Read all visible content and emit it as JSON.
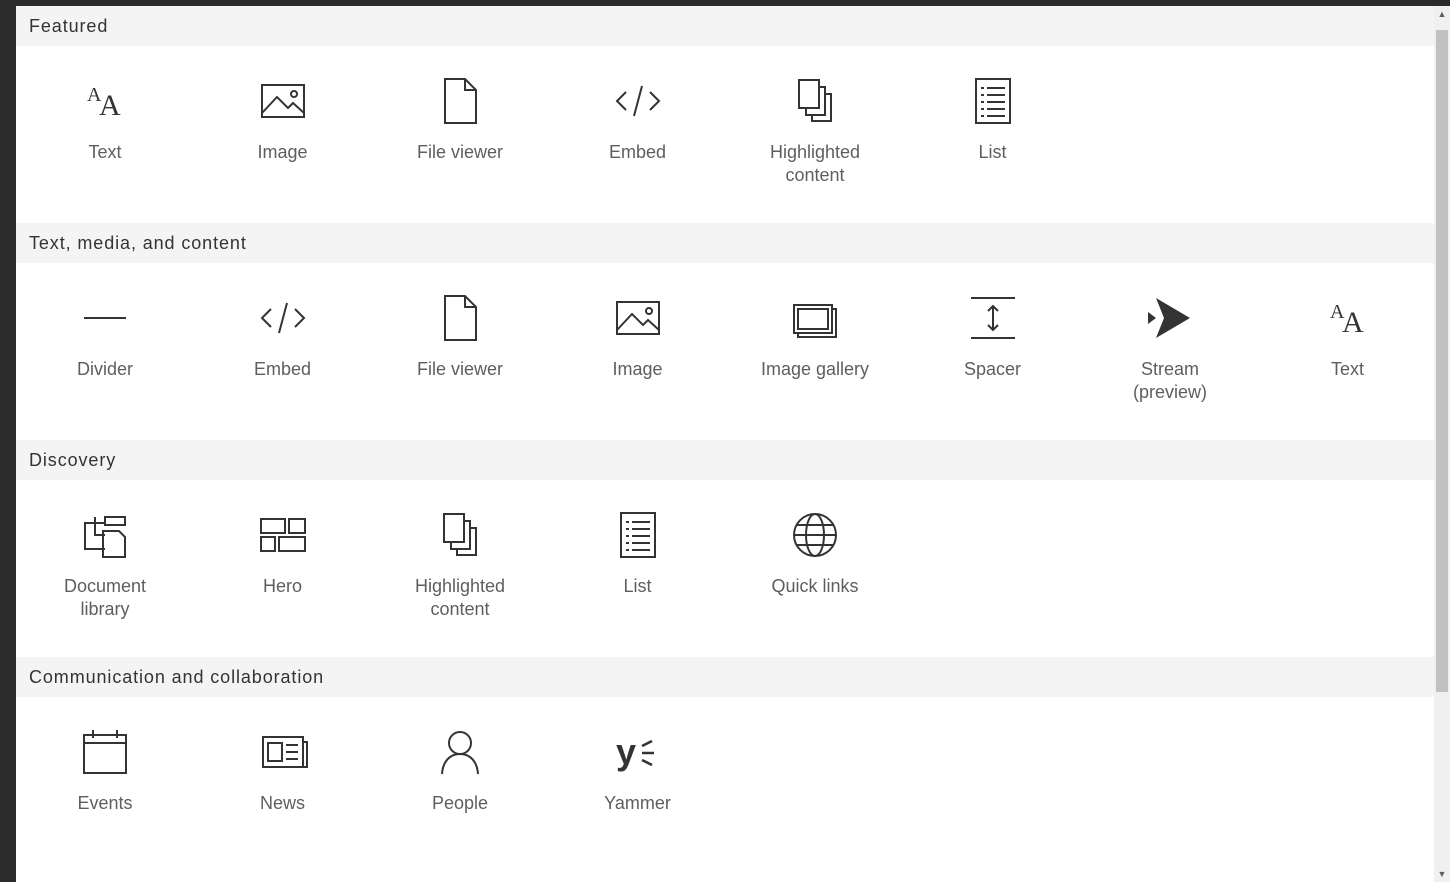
{
  "sections": [
    {
      "title": "Featured",
      "items": [
        {
          "label": "Text",
          "icon": "text-icon"
        },
        {
          "label": "Image",
          "icon": "image-icon"
        },
        {
          "label": "File viewer",
          "icon": "file-viewer-icon"
        },
        {
          "label": "Embed",
          "icon": "embed-icon"
        },
        {
          "label": "Highlighted content",
          "icon": "highlighted-content-icon"
        },
        {
          "label": "List",
          "icon": "list-icon"
        }
      ]
    },
    {
      "title": "Text, media, and content",
      "items": [
        {
          "label": "Divider",
          "icon": "divider-icon"
        },
        {
          "label": "Embed",
          "icon": "embed-icon"
        },
        {
          "label": "File viewer",
          "icon": "file-viewer-icon"
        },
        {
          "label": "Image",
          "icon": "image-icon"
        },
        {
          "label": "Image gallery",
          "icon": "image-gallery-icon"
        },
        {
          "label": "Spacer",
          "icon": "spacer-icon"
        },
        {
          "label": "Stream (preview)",
          "icon": "stream-icon"
        },
        {
          "label": "Text",
          "icon": "text-icon"
        }
      ]
    },
    {
      "title": "Discovery",
      "items": [
        {
          "label": "Document library",
          "icon": "document-library-icon"
        },
        {
          "label": "Hero",
          "icon": "hero-icon"
        },
        {
          "label": "Highlighted content",
          "icon": "highlighted-content-icon"
        },
        {
          "label": "List",
          "icon": "list-icon"
        },
        {
          "label": "Quick links",
          "icon": "quick-links-icon"
        }
      ]
    },
    {
      "title": "Communication and collaboration",
      "items": [
        {
          "label": "Events",
          "icon": "events-icon"
        },
        {
          "label": "News",
          "icon": "news-icon"
        },
        {
          "label": "People",
          "icon": "people-icon"
        },
        {
          "label": "Yammer",
          "icon": "yammer-icon"
        }
      ]
    }
  ],
  "colors": {
    "background": "#2b2b2b",
    "header_bg": "#f4f4f4",
    "label": "#605e5c",
    "icon": "#333333"
  }
}
